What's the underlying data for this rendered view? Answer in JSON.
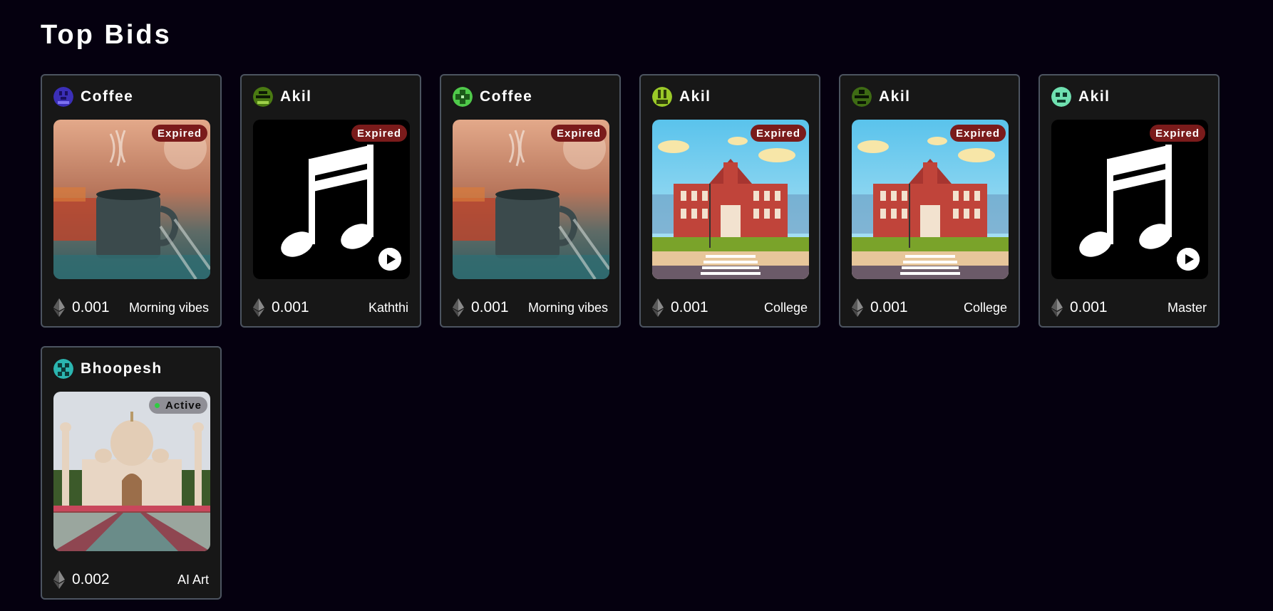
{
  "page": {
    "title": "Top Bids"
  },
  "cards": [
    {
      "owner": "Coffee",
      "status": "Expired",
      "price": "0.001",
      "name": "Morning vibes",
      "image": "coffee-image",
      "avatar_color": "#3b2fb8"
    },
    {
      "owner": "Akil",
      "status": "Expired",
      "price": "0.001",
      "name": "Kaththi",
      "image": "music-note-image",
      "avatar_color": "#4a7a12"
    },
    {
      "owner": "Coffee",
      "status": "Expired",
      "price": "0.001",
      "name": "Morning vibes",
      "image": "coffee-image",
      "avatar_color": "#4fc94a"
    },
    {
      "owner": "Akil",
      "status": "Expired",
      "price": "0.001",
      "name": "College",
      "image": "college-image",
      "avatar_color": "#9ac928"
    },
    {
      "owner": "Akil",
      "status": "Expired",
      "price": "0.001",
      "name": "College",
      "image": "college-image",
      "avatar_color": "#3e6b14"
    },
    {
      "owner": "Akil",
      "status": "Expired",
      "price": "0.001",
      "name": "Master",
      "image": "music-note-image",
      "avatar_color": "#6fe0b0"
    },
    {
      "owner": "Bhoopesh",
      "status": "Active",
      "price": "0.002",
      "name": "AI Art",
      "image": "taj-mahal-image",
      "avatar_color": "#2bb5b0"
    }
  ],
  "colors": {
    "background": "#05000f",
    "card": "#171717",
    "card_border": "#4c5460",
    "expired_badge": "#7a1b1b",
    "active_badge": "#8f8f96",
    "active_dot": "#2ecc40"
  },
  "icons": {
    "currency": "ethereum-icon",
    "play": "play-icon",
    "avatar": "pixel-avatar-icon"
  }
}
